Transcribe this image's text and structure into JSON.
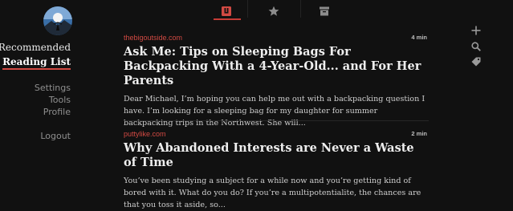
{
  "sidebar": {
    "nav": [
      "Recommended",
      "Reading List"
    ],
    "settings_links": [
      "Settings",
      "Tools",
      "Profile"
    ],
    "logout": "Logout"
  },
  "tabs": [
    {
      "icon": "pocket-icon",
      "active": true
    },
    {
      "icon": "star-icon",
      "active": false
    },
    {
      "icon": "archive-icon",
      "active": false
    }
  ],
  "tools": [
    "plus-icon",
    "search-icon",
    "tag-icon"
  ],
  "colors": {
    "accent": "#d24a43",
    "background": "#111111"
  },
  "articles": [
    {
      "source": "thebigoutside.com",
      "read_time": "4 min",
      "title": "Ask Me: Tips on Sleeping Bags For Backpacking With a 4-Year-Old... and For Her Parents",
      "excerpt": "Dear Michael, I’m hoping you can help me out with a backpacking question I have. I’m looking for a sleeping bag for my daughter for summer backpacking trips in the Northwest. She will..."
    },
    {
      "source": "puttylike.com",
      "read_time": "2 min",
      "title": "Why Abandoned Interests are Never a Waste of Time",
      "excerpt": "You’ve been studying a subject for a while now and you’re getting kind of bored with it. What do you do? If you’re a multipotentialite, the chances are that you toss it aside, so..."
    }
  ]
}
